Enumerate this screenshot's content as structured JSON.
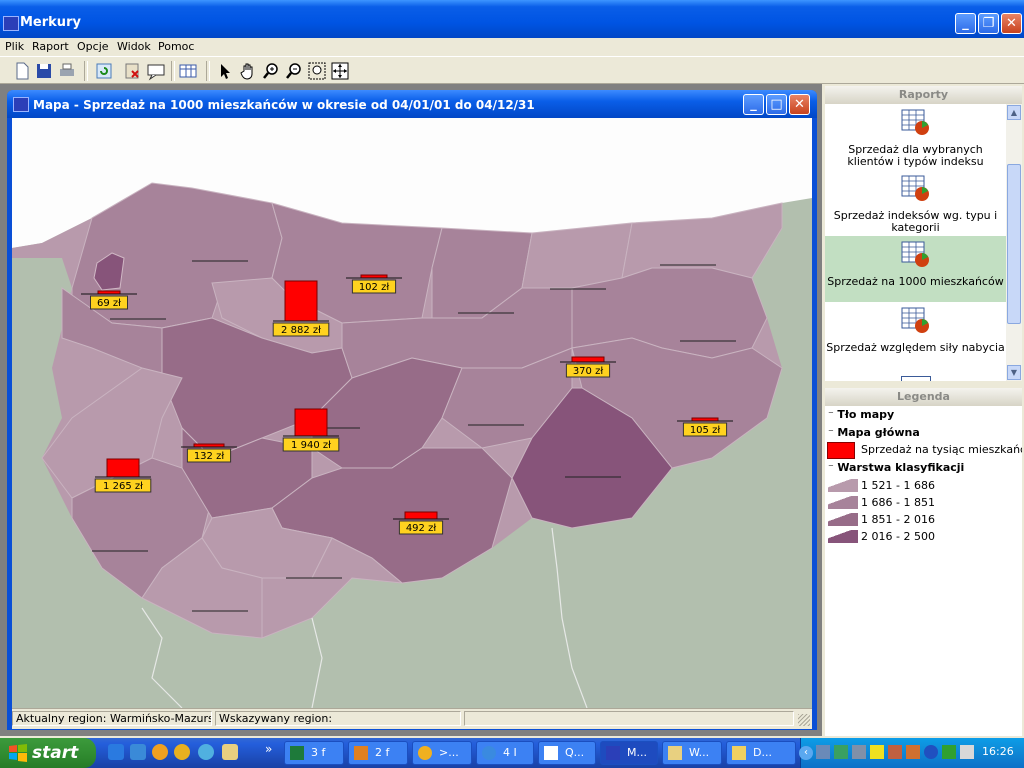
{
  "window": {
    "title": "Merkury"
  },
  "menu": [
    "Plik",
    "Raport",
    "Opcje",
    "Widok",
    "Pomoc"
  ],
  "map_window": {
    "title": "Mapa - Sprzedaż na 1000 mieszkańców w okresie od 04/01/01 do 04/12/31",
    "bars": [
      {
        "label": "69 zł"
      },
      {
        "label": "2 882 zł"
      },
      {
        "label": "102 zł"
      },
      {
        "label": "370 zł"
      },
      {
        "label": "1 940 zł"
      },
      {
        "label": "132 zł"
      },
      {
        "label": "1 265 zł"
      },
      {
        "label": "105 zł"
      },
      {
        "label": "492 zł"
      }
    ]
  },
  "status": {
    "current_region": "Aktualny region: Warmińsko-Mazurskie",
    "pointed_region": "Wskazywany region:"
  },
  "reports": {
    "header": "Raporty",
    "items": [
      {
        "label": "Sprzedaż dla wybranych klientów i typów indeksu",
        "selected": false
      },
      {
        "label": "Sprzedaż indeksów wg. typu i kategorii",
        "selected": false
      },
      {
        "label": "Sprzedaż na 1000 mieszkańców",
        "selected": true
      },
      {
        "label": "Sprzedaż względem siły nabycia",
        "selected": false
      }
    ]
  },
  "legend": {
    "header": "Legenda",
    "background_layer": "Tło mapy",
    "main_map": "Mapa główna",
    "main_map_item": "Sprzedaż na tysiąc mieszkańców",
    "classification_layer": "Warstwa klasyfikacji",
    "classes": [
      {
        "label": "1 521 - 1 686",
        "color": "#b89aac"
      },
      {
        "label": "1 686 - 1 851",
        "color": "#a7839a"
      },
      {
        "label": "1 851 - 2 016",
        "color": "#976c88"
      },
      {
        "label": "2 016 - 2 500",
        "color": "#87547a"
      }
    ]
  },
  "taskbar": {
    "start": "start",
    "tasks": [
      "3 f",
      "2 f",
      ">...",
      "4 I",
      "Q...",
      "M...",
      "W...",
      "D..."
    ],
    "clock": "16:26"
  }
}
